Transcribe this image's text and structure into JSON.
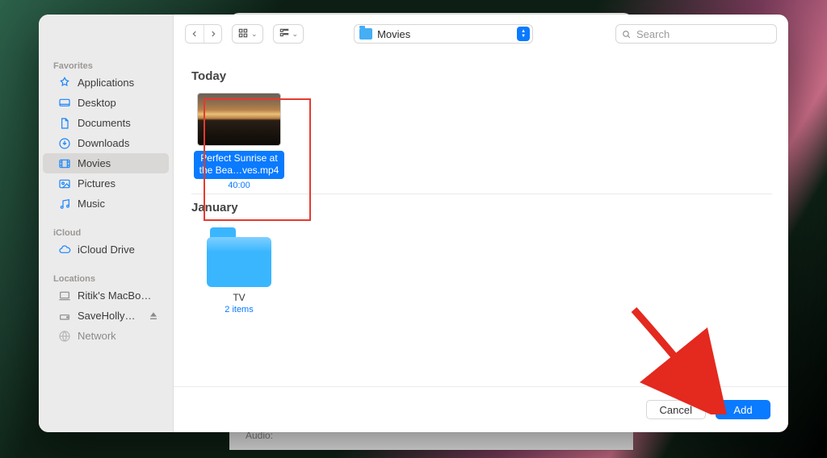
{
  "path_popup": {
    "label": "Movies"
  },
  "search": {
    "placeholder": "Search"
  },
  "sidebar": {
    "sections": {
      "favorites": {
        "label": "Favorites",
        "items": [
          {
            "label": "Applications"
          },
          {
            "label": "Desktop"
          },
          {
            "label": "Documents"
          },
          {
            "label": "Downloads"
          },
          {
            "label": "Movies"
          },
          {
            "label": "Pictures"
          },
          {
            "label": "Music"
          }
        ]
      },
      "icloud": {
        "label": "iCloud",
        "items": [
          {
            "label": "iCloud Drive"
          }
        ]
      },
      "locations": {
        "label": "Locations",
        "items": [
          {
            "label": "Ritik's MacBo…"
          },
          {
            "label": "SaveHolly…"
          },
          {
            "label": "Network"
          }
        ]
      }
    }
  },
  "browse": {
    "groups": [
      {
        "header": "Today",
        "items": [
          {
            "kind": "video",
            "selected": true,
            "name": "Perfect Sunrise at the Bea…ves.mp4",
            "sub": "40:00"
          }
        ]
      },
      {
        "header": "January",
        "items": [
          {
            "kind": "folder",
            "selected": false,
            "name": "TV",
            "sub": "2 items"
          }
        ]
      }
    ]
  },
  "buttons": {
    "cancel": "Cancel",
    "add": "Add"
  },
  "behind_window": {
    "left_hint": "Audio:"
  }
}
